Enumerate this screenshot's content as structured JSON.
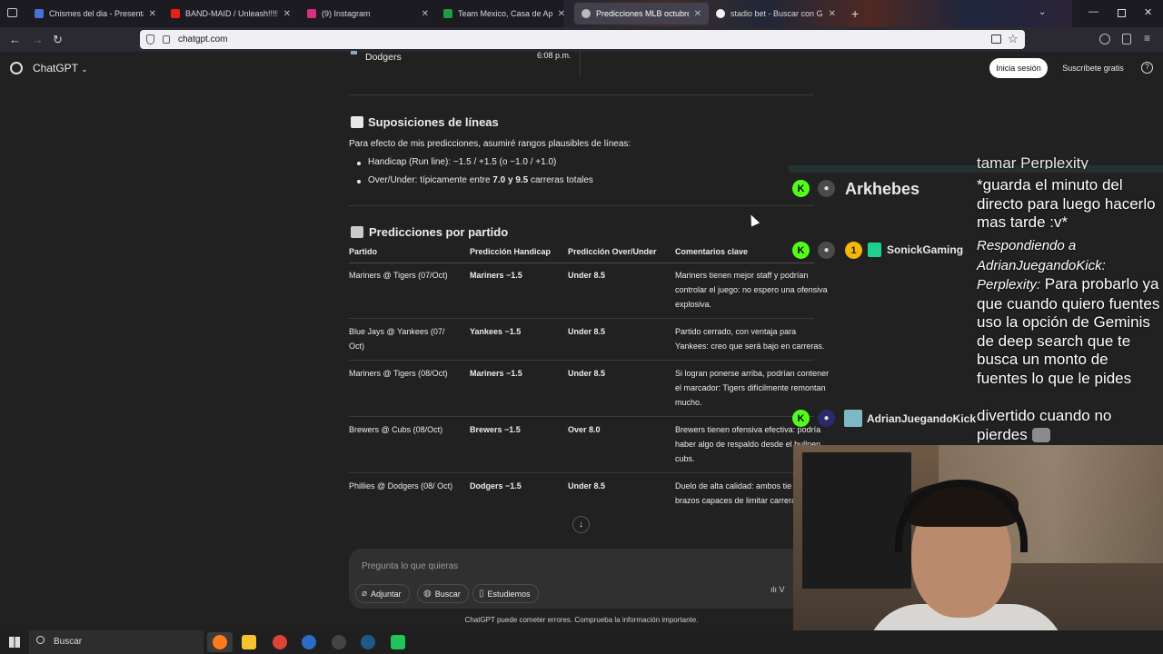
{
  "browser": {
    "tabs": [
      {
        "label": "Chismes del dia - Presentación"
      },
      {
        "label": "BAND-MAID / Unleash!!!!!"
      },
      {
        "label": "(9) Instagram"
      },
      {
        "label": "Team Mexico, Casa de Apuesta"
      },
      {
        "label": "Predicciones MLB octubre 7-8"
      },
      {
        "label": "stadio bet - Buscar con Google"
      }
    ],
    "new_tab": "+",
    "url": "chatgpt.com"
  },
  "header": {
    "title": "ChatGPT",
    "login": "Inicia sesión",
    "signup": "Suscríbete gratis",
    "help": "?"
  },
  "content": {
    "top_row_team": "Dodgers",
    "top_row_time": "6:08 p.m.",
    "lines_section": {
      "title": "Suposiciones de líneas",
      "intro": "Para efecto de mis predicciones, asumiré rangos plausibles de líneas:",
      "b1": "Handicap (Run line): −1.5 / +1.5 (o −1.0 / +1.0)",
      "b2_prefix": "Over/Under: típicamente entre ",
      "b2_bold": "7.0 y 9.5",
      "b2_suffix": " carreras totales"
    },
    "pred_section": {
      "title": "Predicciones por partido",
      "columns": [
        "Partido",
        "Predicción Handicap",
        "Predicción Over/Under",
        "Comentarios clave"
      ],
      "rows": [
        {
          "game": "Mariners @ Tigers (07/Oct)",
          "handicap": "Mariners −1.5",
          "ou": "Under 8.5",
          "comment": "Mariners tienen mejor staff y podrían controlar el juego: no espero una ofensiva explosiva."
        },
        {
          "game": "Blue Jays @ Yankees (07/ Oct)",
          "handicap": "Yankees −1.5",
          "ou": "Under 8.5",
          "comment": "Partido cerrado, con ventaja para Yankees: creo que será bajo en carreras."
        },
        {
          "game": "Mariners @ Tigers (08/Oct)",
          "handicap": "Mariners −1.5",
          "ou": "Under 8.5",
          "comment": "Si logran ponerse arriba, podrían contener el marcador: Tigers difícilmente remontan mucho."
        },
        {
          "game": "Brewers @ Cubs (08/Oct)",
          "handicap": "Brewers −1.5",
          "ou": "Over 8.0",
          "comment": "Brewers tienen ofensiva efectiva: podría haber algo de respaldo desde el bullpen cubs."
        },
        {
          "game": "Phillies @ Dodgers (08/ Oct)",
          "handicap": "Dodgers −1.5",
          "ou": "Under 8.5",
          "comment": "Duelo de alta calidad: ambos tie brazos capaces de limitar carrera"
        }
      ]
    }
  },
  "composer": {
    "placeholder": "Pregunta lo que quieras",
    "attach": "Adjuntar",
    "search": "Buscar",
    "study": "Estudiemos",
    "voice": "V",
    "scroll_down": "↓",
    "disclaimer": "ChatGPT puede cometer errores. Comprueba la información importante."
  },
  "stream_chat": {
    "top_cut_text": "tamar Perplexity",
    "messages": [
      {
        "user": "Arkhebes",
        "text": "*guarda el minuto del directo para luego hacerlo mas tarde :v*"
      },
      {
        "user": "SonickGaming",
        "badge": "1",
        "reply_to": "Respondiendo a AdrianJuegandoKick: Perplexity:",
        "text": "Para probarlo ya que cuando quiero fuentes uso la opción de Geminis de deep search que te busca un monto de fuentes lo que le pides"
      },
      {
        "user": "AdrianJuegandoKick",
        "text": "divertido cuando no pierdes"
      }
    ]
  },
  "taskbar": {
    "search": "Buscar"
  },
  "colors": {
    "background": "#212121",
    "kick_green": "#53fc18",
    "composer": "#303030"
  }
}
